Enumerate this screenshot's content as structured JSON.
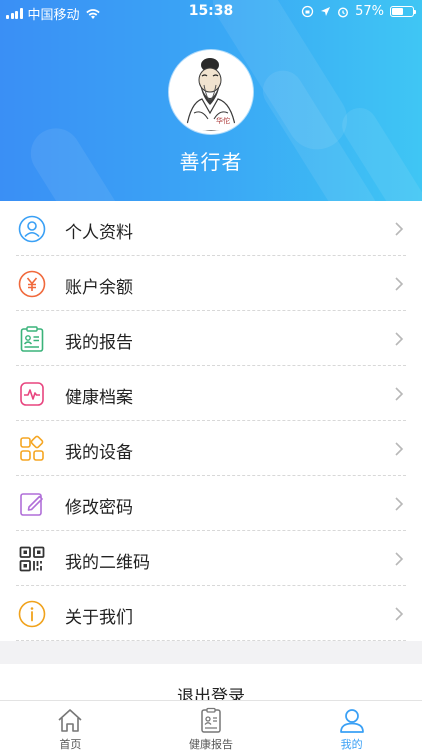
{
  "status_bar": {
    "carrier": "中国移动",
    "time": "15:38",
    "battery": "57%",
    "battery_level": 0.57
  },
  "profile": {
    "username": "善行者",
    "avatar_caption": "华佗"
  },
  "menu": {
    "items": [
      {
        "label": "个人资料",
        "icon": "user-icon",
        "color": "#3aa0f5"
      },
      {
        "label": "账户余额",
        "icon": "yuan-icon",
        "color": "#f0693c"
      },
      {
        "label": "我的报告",
        "icon": "report-icon",
        "color": "#3ab37a"
      },
      {
        "label": "健康档案",
        "icon": "health-record-icon",
        "color": "#e8457f"
      },
      {
        "label": "我的设备",
        "icon": "devices-icon",
        "color": "#f5a623"
      },
      {
        "label": "修改密码",
        "icon": "edit-icon",
        "color": "#b06fd8"
      },
      {
        "label": "我的二维码",
        "icon": "qr-code-icon",
        "color": "#333333"
      },
      {
        "label": "关于我们",
        "icon": "info-icon",
        "color": "#f0a21c"
      }
    ]
  },
  "logout": {
    "label": "退出登录"
  },
  "tabbar": {
    "tabs": [
      {
        "label": "首页",
        "icon": "home-icon"
      },
      {
        "label": "健康报告",
        "icon": "clipboard-icon"
      },
      {
        "label": "我的",
        "icon": "profile-icon",
        "active": true
      }
    ]
  },
  "colors": {
    "accent": "#3aa0f5",
    "header_start": "#3a8ff5",
    "header_end": "#3fc6f4"
  }
}
